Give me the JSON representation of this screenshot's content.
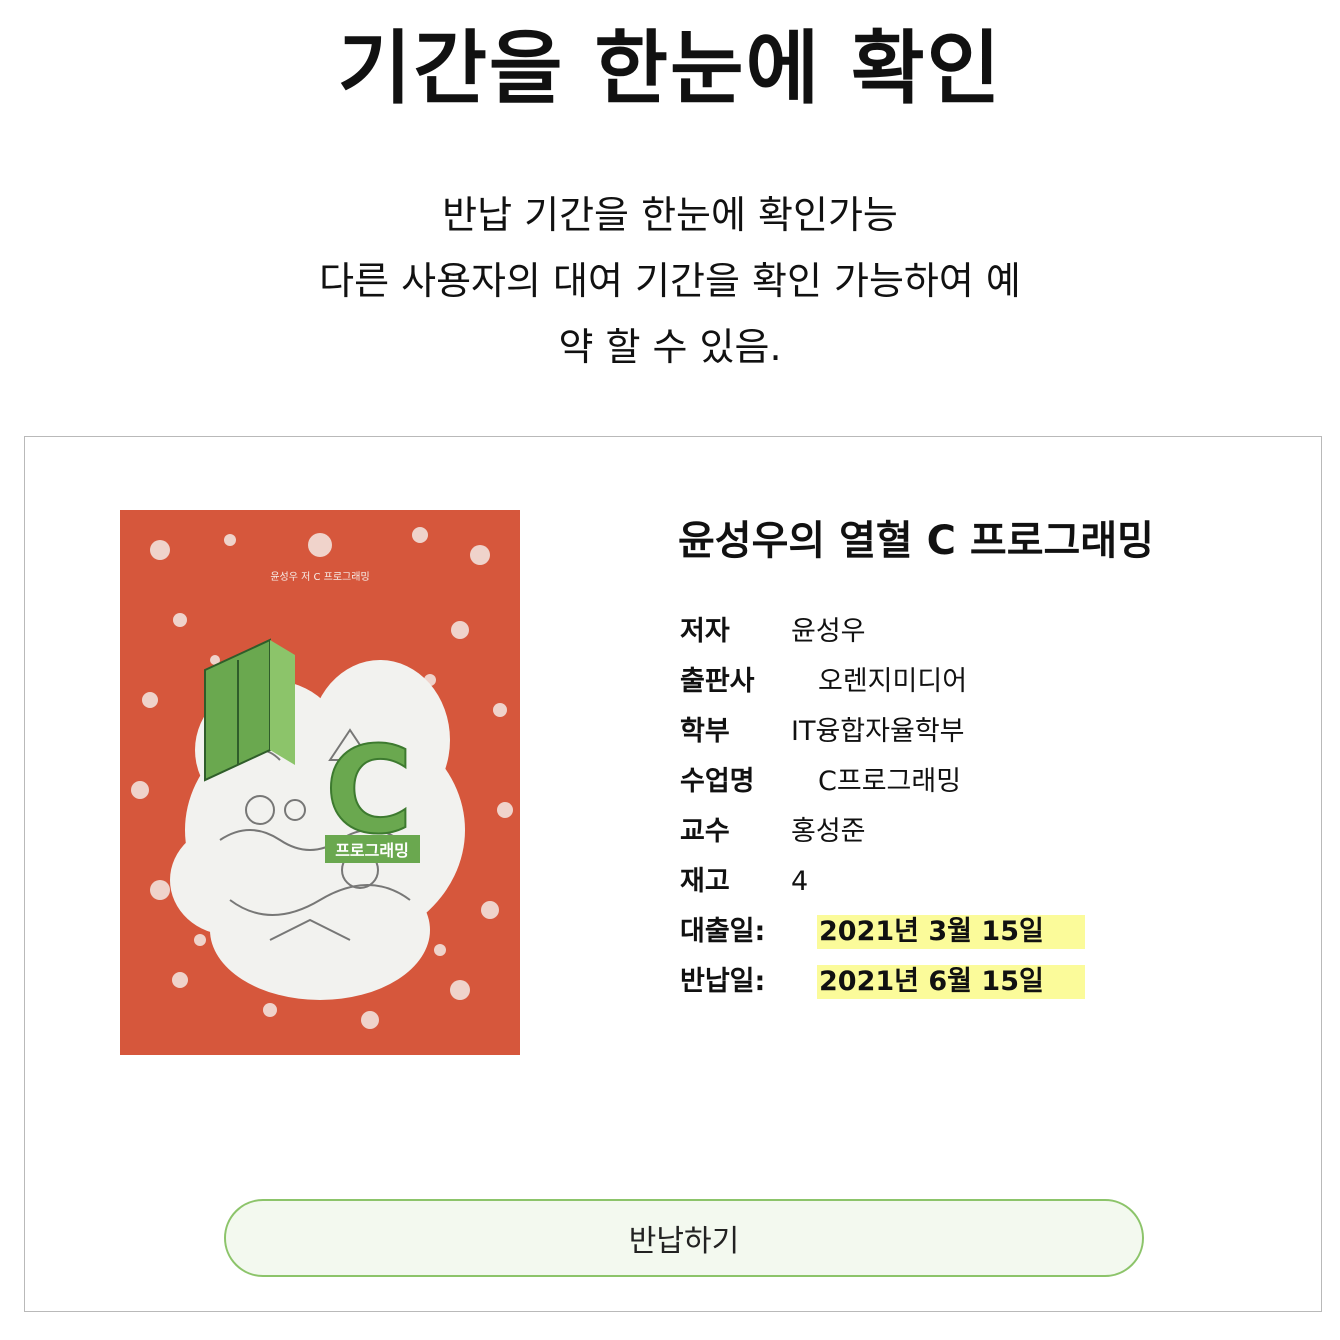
{
  "page": {
    "title": "기간을 한눈에 확인",
    "description_lines": [
      "반납 기간을 한눈에 확인가능",
      "다른 사용자의 대여 기간을 확인 가능하여 예",
      "약 할 수 있음."
    ]
  },
  "book": {
    "title": "윤성우의 열혈 C 프로그래밍",
    "cover": {
      "alt": "book-cover",
      "background_color": "#d6573c",
      "accent_color": "#6aa84f",
      "cover_texts": [
        "윤성우 저",
        "C 프로그래밍",
        "C",
        "프로그래밍"
      ]
    },
    "fields": [
      {
        "label": "저자",
        "value": "윤성우"
      },
      {
        "label": "출판사",
        "value": "오렌지미디어"
      },
      {
        "label": "학부",
        "value": "IT융합자율학부"
      },
      {
        "label": "수업명",
        "value": "C프로그래밍"
      },
      {
        "label": "교수",
        "value": "홍성준"
      },
      {
        "label": "재고",
        "value": "4"
      }
    ],
    "dates": [
      {
        "label": "대출일:",
        "value": "2021년 3월 15일"
      },
      {
        "label": "반납일:",
        "value": "2021년 6월 15일"
      }
    ],
    "highlight_color": "#fbfb9a"
  },
  "actions": {
    "return_button": "반납하기",
    "button_border_color": "#8cc46a"
  }
}
